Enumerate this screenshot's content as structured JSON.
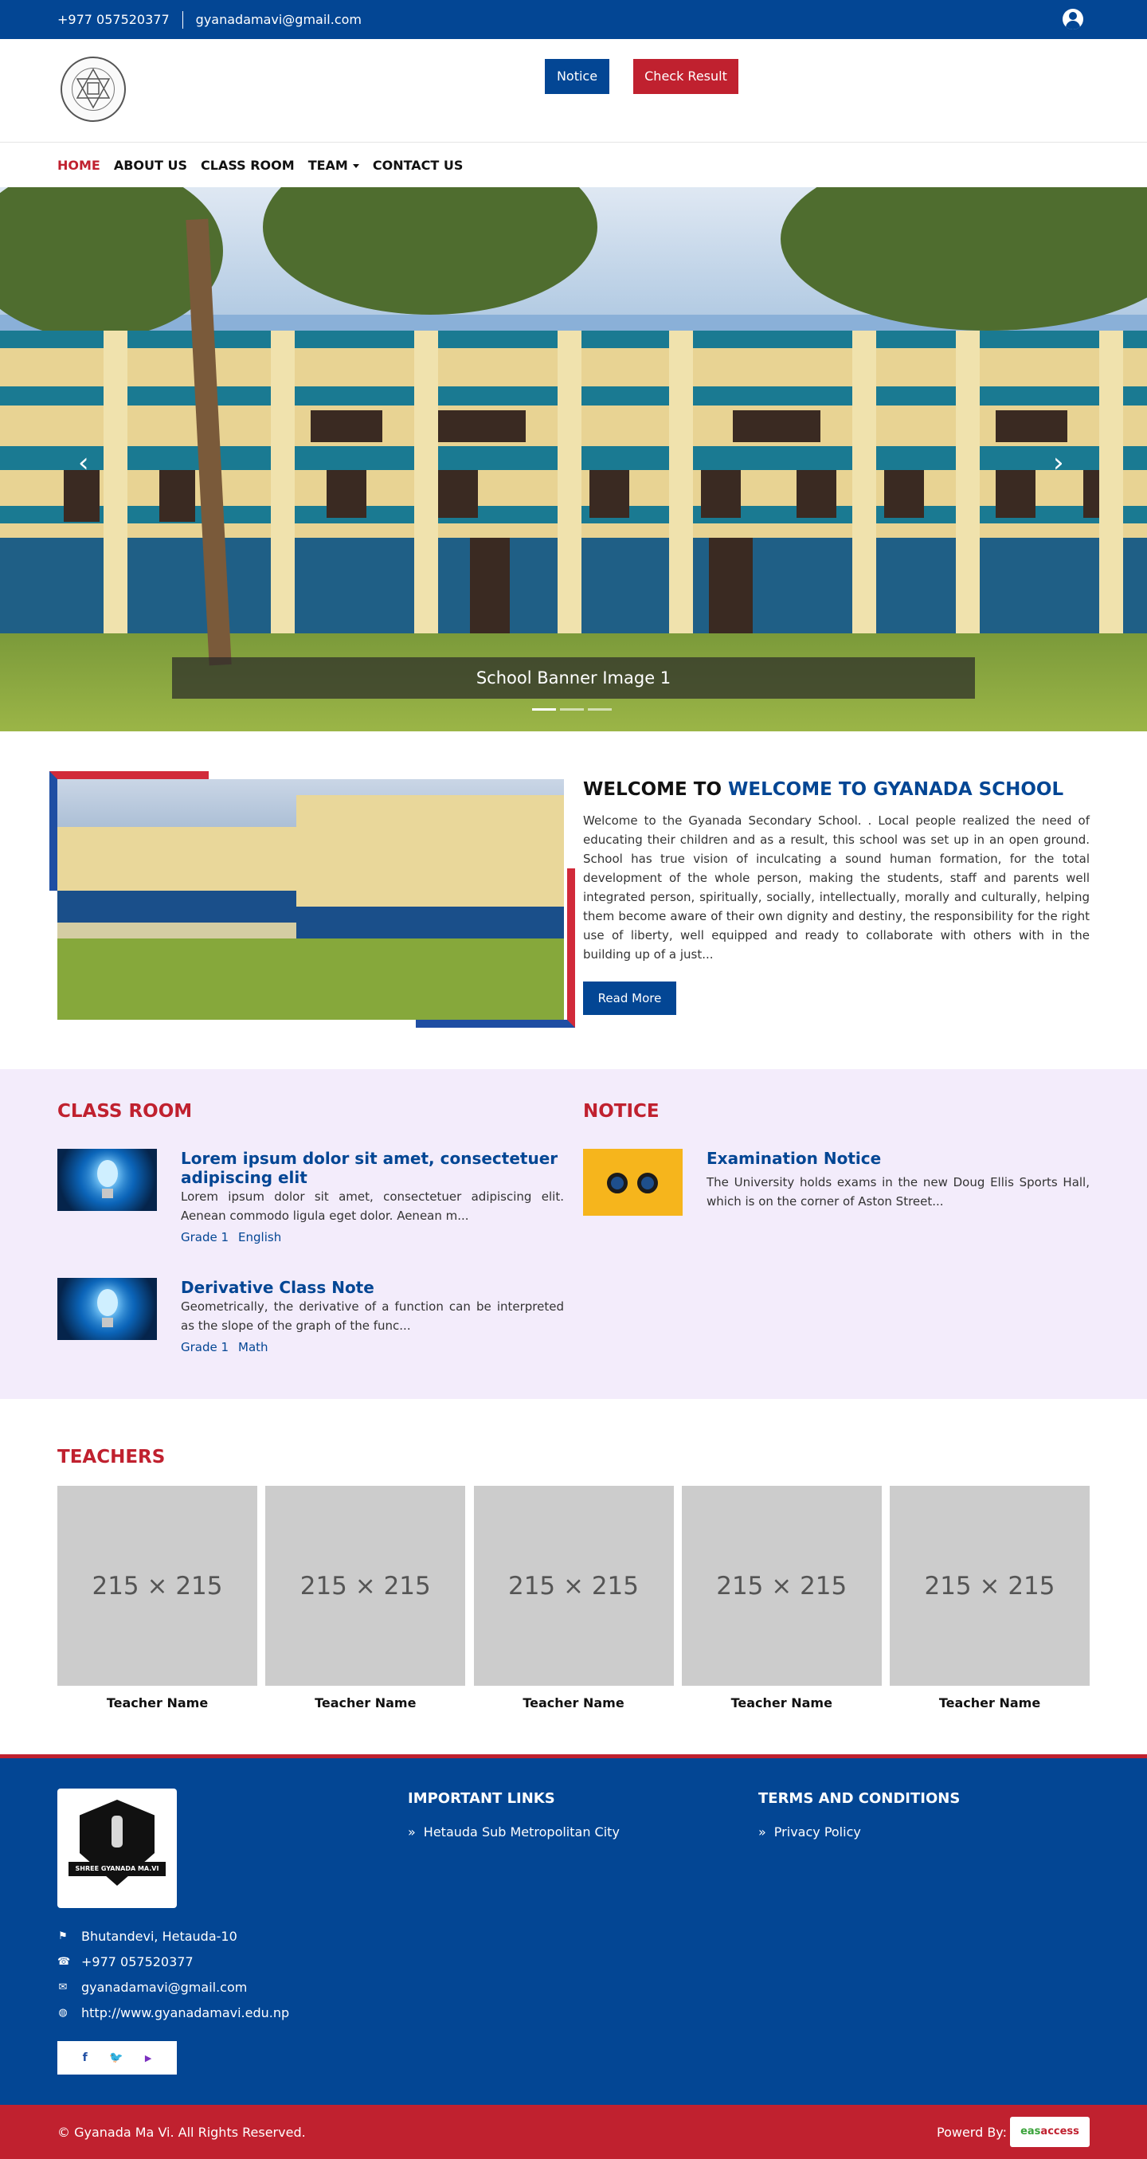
{
  "topbar": {
    "phone": "+977 057520377",
    "email": "gyanadamavi@gmail.com",
    "user_icon": "user-circle-icon"
  },
  "header": {
    "logo_icon": "school-seal-icon",
    "notice_label": "Notice",
    "result_label": "Check Result"
  },
  "nav": {
    "items": [
      {
        "label": "HOME"
      },
      {
        "label": "ABOUT US"
      },
      {
        "label": "CLASS ROOM"
      },
      {
        "label": "TEAM"
      },
      {
        "label": "CONTACT US"
      }
    ]
  },
  "banner": {
    "caption": "School Banner Image 1",
    "prev_icon": "chevron-left-icon",
    "next_icon": "chevron-right-icon",
    "active_slide": 1,
    "slides": 3
  },
  "welcome": {
    "title_prefix": "WELCOME TO",
    "title_highlight": "WELCOME TO GYANADA SCHOOL",
    "body": "Welcome to the Gyanada Secondary School. . Local people realized the need of educating their children and as a result, this school was set up in an open ground.  School has true vision of inculcating a sound human formation, for the total development of the whole person, making the students, staff and parents well integrated person, spiritually, socially, intellectually, morally and culturally, helping them become aware of their own dignity and destiny, the responsibility for the right use of liberty, well equipped and ready to collaborate with others with in the building up of a just...",
    "read_more": "Read More"
  },
  "classroom": {
    "heading": "CLASS ROOM",
    "items": [
      {
        "title": "Lorem ipsum dolor sit amet, consectetuer adipiscing elit",
        "excerpt": "Lorem ipsum dolor sit amet, consectetuer adipiscing elit. Aenean commodo ligula eget dolor. Aenean m...",
        "grade": "Grade 1",
        "subject": "English"
      },
      {
        "title": "Derivative Class Note",
        "excerpt": "Geometrically, the derivative of a function can be interpreted as the slope of the graph of the func...",
        "grade": "Grade 1",
        "subject": "Math"
      }
    ]
  },
  "notice": {
    "heading": "NOTICE",
    "items": [
      {
        "title": "Examination Notice",
        "excerpt": "The University holds exams in the new Doug Ellis Sports Hall, which is on the corner of Aston Street..."
      }
    ]
  },
  "teachers": {
    "heading": "TEACHERS",
    "items": [
      {
        "placeholder": "215 × 215",
        "name": "Teacher Name"
      },
      {
        "placeholder": "215 × 215",
        "name": "Teacher Name"
      },
      {
        "placeholder": "215 × 215",
        "name": "Teacher Name"
      },
      {
        "placeholder": "215 × 215",
        "name": "Teacher Name"
      },
      {
        "placeholder": "215 × 215",
        "name": "Teacher Name"
      }
    ]
  },
  "footer": {
    "logo_text": "SHREE GYANADA MA.VI",
    "address": "Bhutandevi, Hetauda-10",
    "phone": "+977 057520377",
    "email": "gyanadamavi@gmail.com",
    "website": "http://www.gyanadamavi.edu.np",
    "links_heading": "IMPORTANT LINKS",
    "links": [
      {
        "label": "Hetauda Sub Metropolitan City"
      }
    ],
    "terms_heading": "TERMS AND CONDITIONS",
    "terms": [
      {
        "label": "Privacy Policy"
      }
    ],
    "social": {
      "facebook": "f",
      "twitter": "🐦",
      "youtube": "▶"
    },
    "copyright": "© Gyanada Ma Vi. All Rights Reserved.",
    "powered_by": "Powerd By:",
    "brand_a": "eas",
    "brand_b": "access"
  },
  "colors": {
    "primary_blue": "#034694",
    "accent_red": "#c0212f",
    "lavender": "#f3ecfb"
  }
}
